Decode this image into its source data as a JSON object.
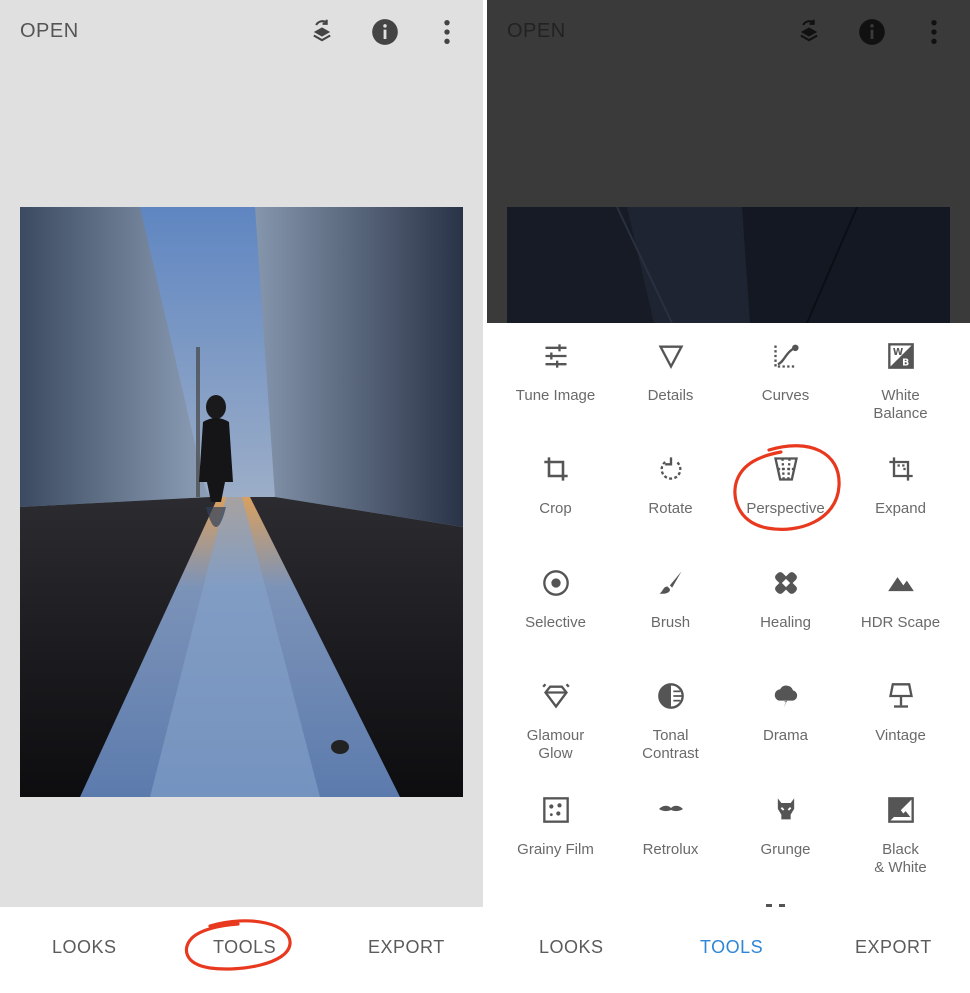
{
  "left_screen": {
    "open_label": "OPEN",
    "icons": [
      "layers-rotate-icon",
      "info-icon",
      "more-vert-icon"
    ],
    "photo_alt": "photo",
    "nav": {
      "looks": "LOOKS",
      "tools": "TOOLS",
      "export": "EXPORT"
    }
  },
  "right_screen": {
    "open_label": "OPEN",
    "icons": [
      "layers-rotate-icon",
      "info-icon",
      "more-vert-icon"
    ],
    "nav": {
      "looks": "LOOKS",
      "tools": "TOOLS",
      "export": "EXPORT",
      "active": "TOOLS"
    },
    "tools": [
      {
        "label": "Tune Image",
        "icon": "tune-image-icon"
      },
      {
        "label": "Details",
        "icon": "details-icon"
      },
      {
        "label": "Curves",
        "icon": "curves-icon"
      },
      {
        "label": "White\nBalance",
        "icon": "white-balance-icon"
      },
      {
        "label": "Crop",
        "icon": "crop-icon"
      },
      {
        "label": "Rotate",
        "icon": "rotate-icon"
      },
      {
        "label": "Perspective",
        "icon": "perspective-icon"
      },
      {
        "label": "Expand",
        "icon": "expand-icon"
      },
      {
        "label": "Selective",
        "icon": "selective-icon"
      },
      {
        "label": "Brush",
        "icon": "brush-icon"
      },
      {
        "label": "Healing",
        "icon": "healing-icon"
      },
      {
        "label": "HDR Scape",
        "icon": "hdr-scape-icon"
      },
      {
        "label": "Glamour\nGlow",
        "icon": "glamour-glow-icon"
      },
      {
        "label": "Tonal\nContrast",
        "icon": "tonal-contrast-icon"
      },
      {
        "label": "Drama",
        "icon": "drama-icon"
      },
      {
        "label": "Vintage",
        "icon": "vintage-icon"
      },
      {
        "label": "Grainy Film",
        "icon": "grainy-film-icon"
      },
      {
        "label": "Retrolux",
        "icon": "retrolux-icon"
      },
      {
        "label": "Grunge",
        "icon": "grunge-icon"
      },
      {
        "label": "Black\n& White",
        "icon": "black-white-icon"
      }
    ]
  },
  "colors": {
    "accent": "#2f86d6",
    "annotation": "#e8391f",
    "left_bg": "#e0e0e0",
    "right_dim_bg": "#3a3a3a"
  }
}
